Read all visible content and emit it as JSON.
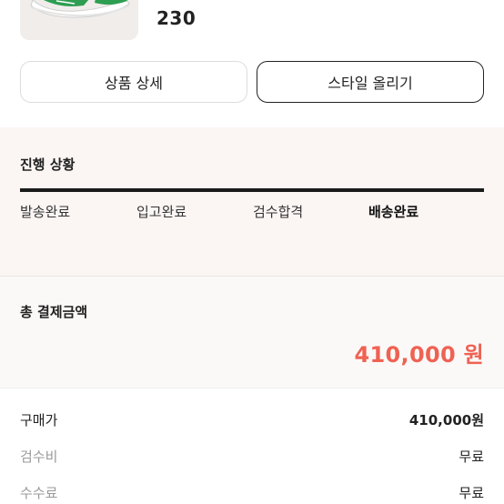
{
  "product": {
    "size": "230"
  },
  "actions": {
    "detail_label": "상품 상세",
    "style_label": "스타일 올리기"
  },
  "progress": {
    "title": "진행 상황",
    "steps": [
      "발송완료",
      "입고완료",
      "검수합격",
      "배송완료"
    ],
    "current_step": "배송완료"
  },
  "total": {
    "title": "총 결제금액",
    "amount": "410,000 원",
    "accent_color": "#ef6253"
  },
  "breakdown": [
    {
      "label": "구매가",
      "value": "410,000원"
    },
    {
      "label": "검수비",
      "value": "무료"
    },
    {
      "label": "수수료",
      "value": "무료"
    }
  ],
  "icons": {
    "product_thumbnail": "sneaker-image"
  }
}
